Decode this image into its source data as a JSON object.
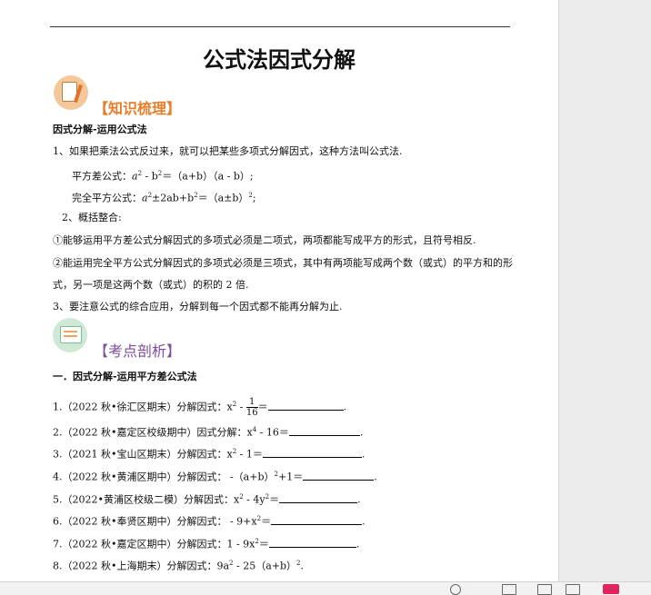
{
  "document": {
    "title": "公式法因式分解",
    "section1": {
      "heading": "【知识梳理】",
      "subheading": "因式分解-运用公式法",
      "p1": "1、如果把乘法公式反过来，就可以把某些多项式分解因式，这种方法叫公式法.",
      "f1_label": "平方差公式：",
      "f1_a": "a",
      "f1_sq1": "2",
      "f1_mid": " - b",
      "f1_sq2": "2",
      "f1_rest": "＝（a+b）（a - b）;",
      "f2_label": "完全平方公式：",
      "f2_a": "a",
      "f2_sq1": "2",
      "f2_mid": "±2ab+b",
      "f2_sq2": "2",
      "f2_eq": "＝（a±b）",
      "f2_sq3": "2",
      "f2_end": ";",
      "p2": "2、概括整合:",
      "p3": "①能够运用平方差公式分解因式的多项式必须是二项式，两项都能写成平方的形式，且符号相反.",
      "p4a": "②能运用完全平方公式分解因式的多项式必须是三项式，其中有两项能写成两个数（或式）的平方和的形",
      "p4b": "式，另一项是这两个数（或式）的积的 2 倍.",
      "p5": "3、要注意公式的综合应用，分解到每一个因式都不能再分解为止."
    },
    "section2": {
      "heading": "【考点剖析】",
      "subheading": "一．因式分解-运用平方差公式法",
      "q1_pre": "1.（2022 秋•徐汇区期末）分解因式：x",
      "q1_sq": "2",
      "q1_minus": " - ",
      "q1_num": "1",
      "q1_den": "16",
      "q1_eq": "＝",
      "q1_end": ".",
      "q2_pre": "2.（2022 秋•嘉定区校级期中）因式分解：x",
      "q2_sq": "4",
      "q2_rest": " - 16＝",
      "q2_end": ".",
      "q3_pre": "3.（2021 秋•宝山区期末）分解因式：x",
      "q3_sq": "2",
      "q3_rest": " - 1＝",
      "q3_end": ".",
      "q4_pre": "4.（2022 秋•黄浦区期中）分解因式：  -（a+b）",
      "q4_sq": "2",
      "q4_rest": "+1＝",
      "q4_end": ".",
      "q5_pre": "5.（2022•黄浦区校级二模）分解因式：x",
      "q5_sq": "2",
      "q5_mid": " - 4y",
      "q5_sq2": "2",
      "q5_rest": "＝",
      "q5_end": ".",
      "q6_pre": "6.（2022 秋•奉贤区期中）分解因式：  - 9+x",
      "q6_sq": "2",
      "q6_rest": "＝",
      "q6_end": ".",
      "q7_pre": "7.（2022 秋•嘉定区期中）分解因式：1 - 9x",
      "q7_sq": "2",
      "q7_rest": "＝",
      "q7_end": ".",
      "q8_pre": "8.（2022 秋•上海期末）分解因式：9a",
      "q8_sq": "2",
      "q8_mid": " - 25（a+b）",
      "q8_sq2": "2",
      "q8_end": "."
    }
  },
  "icons": {
    "section1_icon": "clipboard-pencil-icon",
    "section2_icon": "notebook-icon"
  },
  "colors": {
    "section1_heading": "#e87d2a",
    "section2_heading": "#7d4a9e",
    "status_red": "#e0245e"
  }
}
